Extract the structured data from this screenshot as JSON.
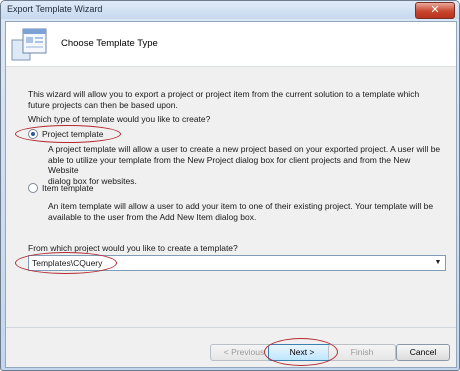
{
  "window": {
    "title": "Export Template Wizard",
    "close_glyph": "✕"
  },
  "header": {
    "title": "Choose Template Type"
  },
  "intro": {
    "line1": "This wizard will allow you to export a project or project item from the current solution to a template which",
    "line2": "future projects can then be based upon."
  },
  "question1": "Which type of template would you like to create?",
  "options": {
    "project": {
      "label": "Project template",
      "selected": true,
      "desc1": "A project template will allow a user to create a new project based on your exported project. A user will be",
      "desc2": "able to utilize your template from the New Project dialog box for client projects and from the New Website",
      "desc3": "dialog box for websites."
    },
    "item": {
      "label": "Item template",
      "selected": false,
      "desc1": "An item template will allow a user to add your item to one of their existing project. Your template will be",
      "desc2": "available to the user from the Add New Item dialog box."
    }
  },
  "question2": "From which project would you like to create a template?",
  "project_select": {
    "value": "Templates\\CQuery",
    "arrow_glyph": "▼"
  },
  "buttons": {
    "previous": "< Previous",
    "next": "Next >",
    "finish": "Finish",
    "cancel": "Cancel"
  },
  "colors": {
    "highlight": "#b32a2f",
    "accent": "#2d5a99"
  },
  "icons": {
    "close": "close-icon",
    "wizard": "wizard-icon",
    "dropdown": "chevron-down-icon"
  }
}
